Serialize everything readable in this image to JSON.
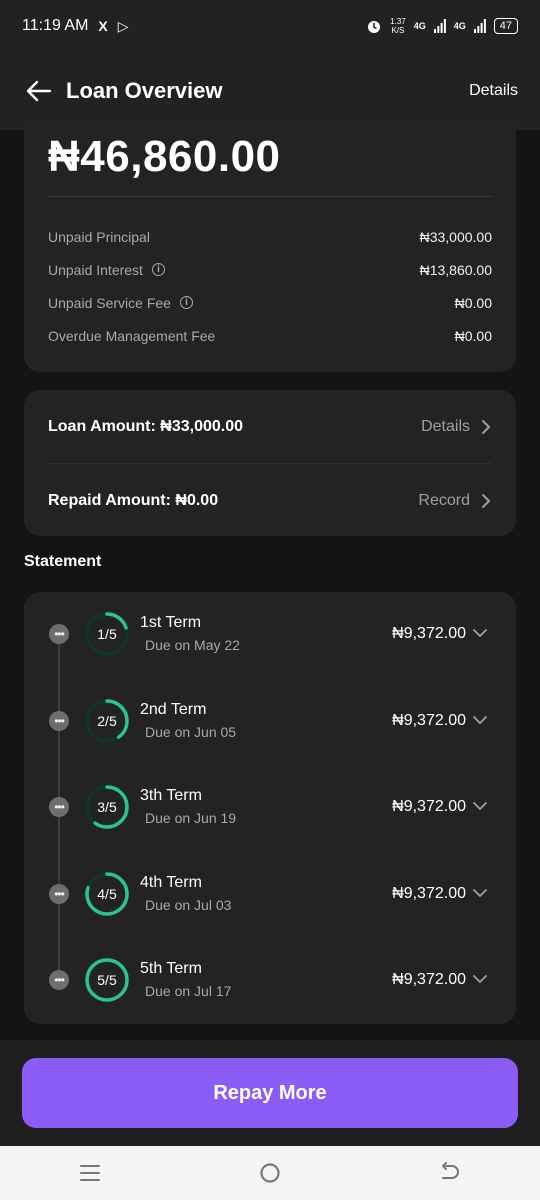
{
  "status_bar": {
    "time": "11:19 AM",
    "x_icon": "X",
    "play_icon": "▷",
    "speed_value": "1.37",
    "speed_unit": "K/S",
    "net1": "4G",
    "net2": "4G",
    "battery": "47"
  },
  "header": {
    "title": "Loan Overview",
    "details_label": "Details"
  },
  "summary": {
    "total": "₦46,860.00",
    "rows": [
      {
        "label": "Unpaid Principal",
        "value": "₦33,000.00",
        "info": false
      },
      {
        "label": "Unpaid Interest",
        "value": "₦13,860.00",
        "info": true
      },
      {
        "label": "Unpaid Service Fee",
        "value": "₦0.00",
        "info": true
      },
      {
        "label": "Overdue Management Fee",
        "value": "₦0.00",
        "info": false
      }
    ]
  },
  "amounts": {
    "loan_amount": "Loan Amount: ₦33,000.00",
    "loan_link": "Details",
    "repaid_amount": "Repaid Amount: ₦0.00",
    "repaid_link": "Record"
  },
  "statement": {
    "title": "Statement",
    "terms": [
      {
        "fraction": "1/5",
        "progress": 0.2,
        "name": "1st Term",
        "due": "Due on May 22",
        "amount": "₦9,372.00"
      },
      {
        "fraction": "2/5",
        "progress": 0.4,
        "name": "2nd Term",
        "due": "Due on Jun 05",
        "amount": "₦9,372.00"
      },
      {
        "fraction": "3/5",
        "progress": 0.6,
        "name": "3th Term",
        "due": "Due on Jun 19",
        "amount": "₦9,372.00"
      },
      {
        "fraction": "4/5",
        "progress": 0.8,
        "name": "4th Term",
        "due": "Due on Jul 03",
        "amount": "₦9,372.00"
      },
      {
        "fraction": "5/5",
        "progress": 1.0,
        "name": "5th Term",
        "due": "Due on Jul 17",
        "amount": "₦9,372.00"
      }
    ]
  },
  "repay_button": "Repay More",
  "colors": {
    "accent": "#8b5cf6",
    "ring_progress": "#2bc48a",
    "ring_track": "#103524"
  },
  "nav": {
    "menu_icon": "menu-icon",
    "home_icon": "home-circle-icon",
    "back_icon": "back-arrow-icon"
  }
}
